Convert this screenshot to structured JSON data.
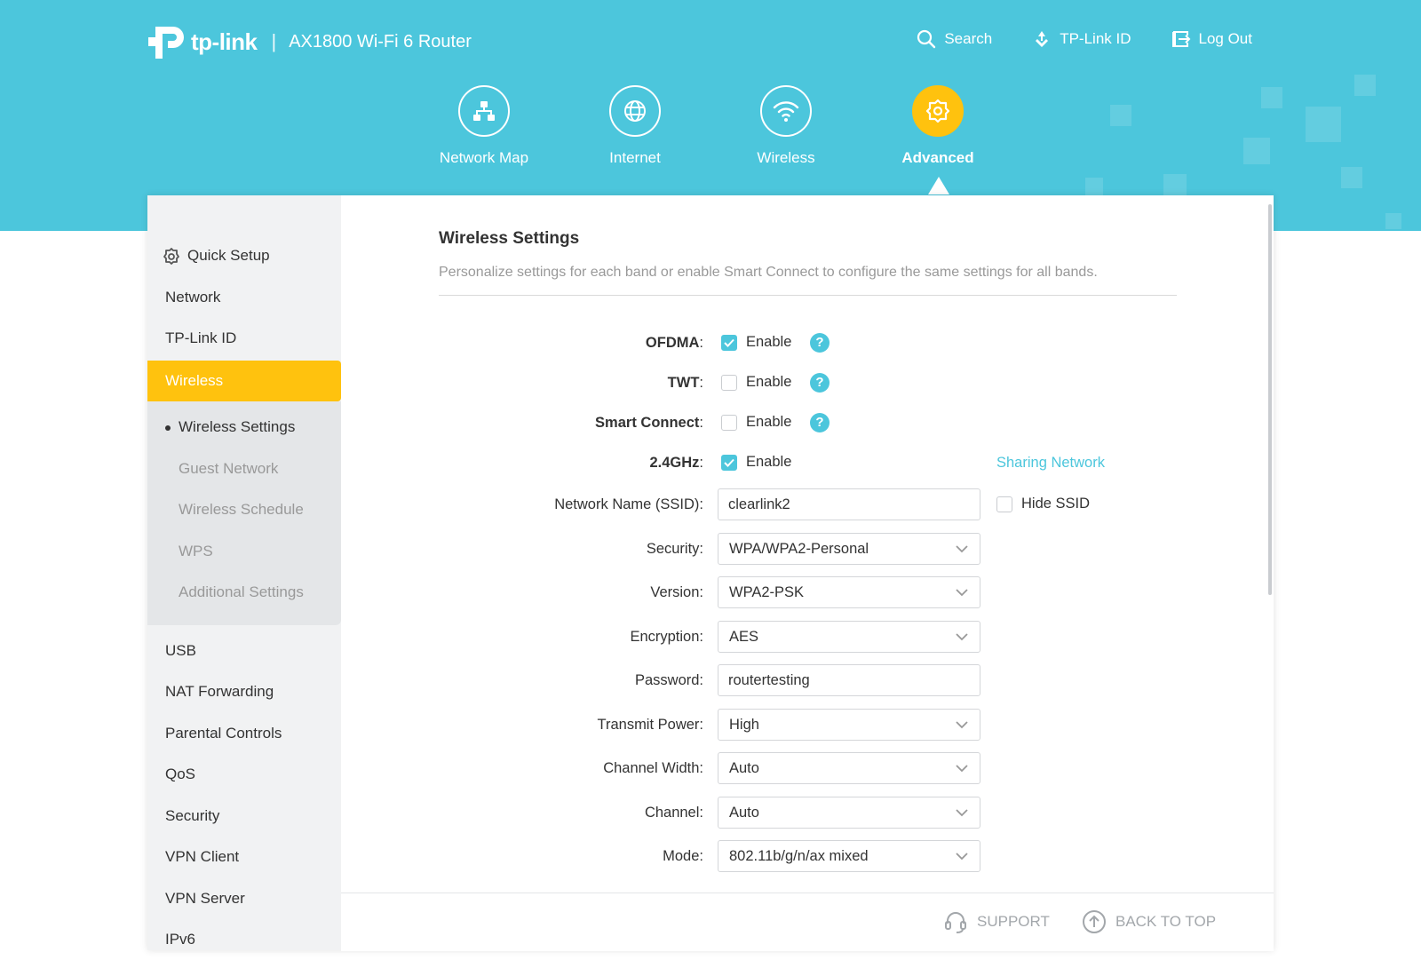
{
  "brand": {
    "name": "tp-link",
    "separator": "|",
    "model": "AX1800 Wi-Fi 6 Router"
  },
  "colors": {
    "header": "#4cc6dc",
    "accent": "#ffc20e",
    "checkbox_checked": "#4cc6dc",
    "link": "#4cc6dc"
  },
  "toplinks": {
    "search": "Search",
    "tplink_id": "TP-Link ID",
    "logout": "Log Out"
  },
  "mainnav": [
    {
      "label": "Network Map",
      "icon": "network-map-icon"
    },
    {
      "label": "Internet",
      "icon": "globe-icon"
    },
    {
      "label": "Wireless",
      "icon": "wifi-icon"
    },
    {
      "label": "Advanced",
      "icon": "gear-icon",
      "active": true
    }
  ],
  "sidebar": {
    "quick_setup": "Quick Setup",
    "network": "Network",
    "tplink_id": "TP-Link ID",
    "wireless": "Wireless",
    "sub": {
      "wireless_settings": "Wireless Settings",
      "guest_network": "Guest Network",
      "wireless_schedule": "Wireless Schedule",
      "wps": "WPS",
      "additional_settings": "Additional Settings"
    },
    "usb": "USB",
    "nat_forwarding": "NAT Forwarding",
    "parental_controls": "Parental Controls",
    "qos": "QoS",
    "security": "Security",
    "vpn_client": "VPN Client",
    "vpn_server": "VPN Server",
    "ipv6": "IPv6"
  },
  "content": {
    "title": "Wireless Settings",
    "description": "Personalize settings for each band or enable Smart Connect to configure the same settings for all bands.",
    "enable_label": "Enable",
    "help_glyph": "?",
    "ofdma": {
      "label": "OFDMA",
      "checked": true
    },
    "twt": {
      "label": "TWT",
      "checked": false
    },
    "smart_connect": {
      "label": "Smart Connect",
      "checked": false
    },
    "band24": {
      "label": "2.4GHz",
      "checked": true
    },
    "colon": ":",
    "sharing_network": "Sharing Network",
    "ssid": {
      "label": "Network Name (SSID):",
      "value": "clearlink2"
    },
    "hide_ssid": {
      "label": "Hide SSID",
      "checked": false
    },
    "security": {
      "label": "Security:",
      "value": "WPA/WPA2-Personal"
    },
    "version": {
      "label": "Version:",
      "value": "WPA2-PSK"
    },
    "encryption": {
      "label": "Encryption:",
      "value": "AES"
    },
    "password": {
      "label": "Password:",
      "value": "routertesting"
    },
    "transmit_power": {
      "label": "Transmit Power:",
      "value": "High"
    },
    "channel_width": {
      "label": "Channel Width:",
      "value": "Auto"
    },
    "channel": {
      "label": "Channel:",
      "value": "Auto"
    },
    "mode": {
      "label": "Mode:",
      "value": "802.11b/g/n/ax mixed"
    }
  },
  "footer": {
    "support": "SUPPORT",
    "back_to_top": "BACK TO TOP"
  }
}
